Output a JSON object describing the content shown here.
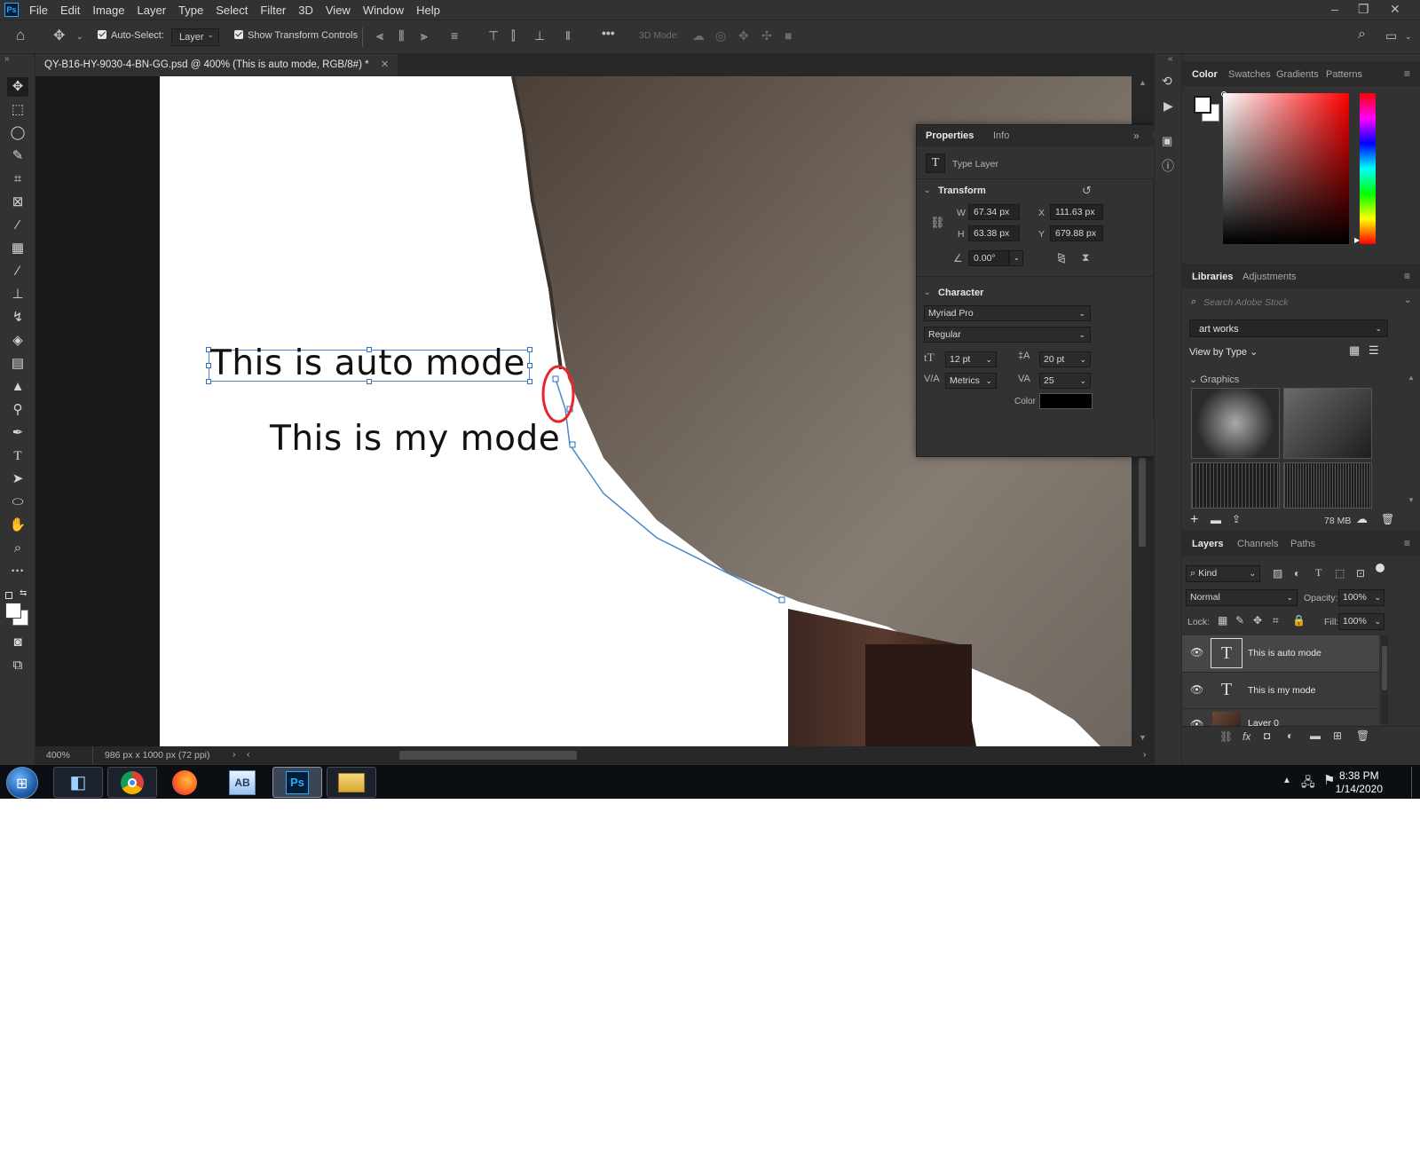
{
  "menu": [
    "File",
    "Edit",
    "Image",
    "Layer",
    "Type",
    "Select",
    "Filter",
    "3D",
    "View",
    "Window",
    "Help"
  ],
  "app_logo": "Ps",
  "options_bar": {
    "auto_select_label": "Auto-Select:",
    "auto_select_target": "Layer",
    "show_transform_label": "Show Transform Controls",
    "mode_3d_label": "3D Mode:"
  },
  "document": {
    "tab_title": "QY-B16-HY-9030-4-BN-GG.psd @ 400% (This is auto mode, RGB/8#) *",
    "text_auto": "This is auto mode",
    "text_my": "This is my mode",
    "zoom": "400%",
    "doc_info": "986 px x 1000 px (72 ppi)"
  },
  "properties": {
    "tabs": [
      "Properties",
      "Info"
    ],
    "layer_type": "Type Layer",
    "transform_title": "Transform",
    "w_label": "W",
    "w_value": "67.34 px",
    "h_label": "H",
    "h_value": "63.38 px",
    "x_label": "X",
    "x_value": "111.63 px",
    "y_label": "Y",
    "y_value": "679.88 px",
    "angle_value": "0.00°",
    "character_title": "Character",
    "font_family": "Myriad Pro",
    "font_style": "Regular",
    "font_size": "12 pt",
    "leading": "20 pt",
    "kerning": "Metrics",
    "tracking": "25",
    "color_label": "Color",
    "text_color": "#000000"
  },
  "color_panel": {
    "tabs": [
      "Color",
      "Swatches",
      "Gradients",
      "Patterns"
    ]
  },
  "libraries": {
    "tabs": [
      "Libraries",
      "Adjustments"
    ],
    "search_placeholder": "Search Adobe Stock",
    "library_name": "art works",
    "view_by": "View by Type",
    "graphics_label": "Graphics",
    "storage": "78 MB"
  },
  "layers": {
    "tabs": [
      "Layers",
      "Channels",
      "Paths"
    ],
    "filter_kind": "Kind",
    "blend_mode": "Normal",
    "opacity_label": "Opacity:",
    "opacity": "100%",
    "lock_label": "Lock:",
    "fill_label": "Fill:",
    "fill": "100%",
    "items": [
      {
        "name": "This is auto mode",
        "selected": true
      },
      {
        "name": "This is my mode",
        "selected": false
      },
      {
        "name": "Layer 0",
        "selected": false
      }
    ]
  },
  "taskbar": {
    "time": "8:38 PM",
    "date": "1/14/2020"
  }
}
